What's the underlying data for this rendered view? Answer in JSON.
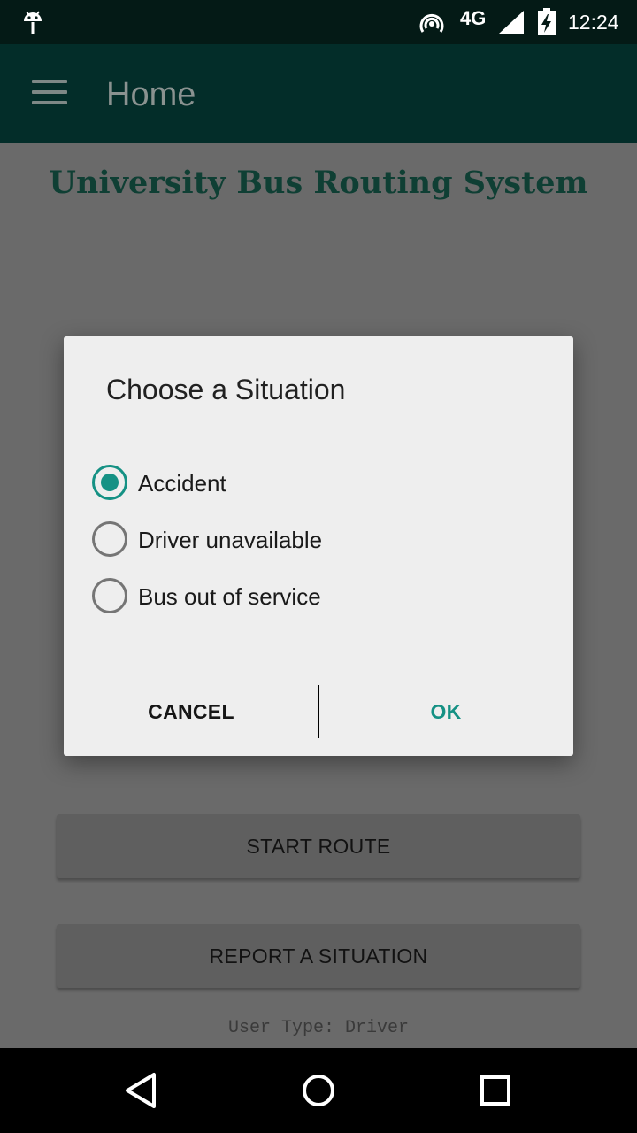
{
  "status_bar": {
    "network_type": "4G",
    "time": "12:24",
    "icons": [
      "android-debug-icon",
      "hotspot-icon",
      "signal-icon",
      "battery-charging-icon"
    ]
  },
  "app_bar": {
    "title": "Home",
    "menu_icon": "hamburger-menu-icon"
  },
  "main": {
    "heading": "University Bus Routing System",
    "start_route_label": "START ROUTE",
    "report_situation_label": "REPORT A SITUATION",
    "user_type_text": "User Type: Driver"
  },
  "dialog": {
    "title": "Choose a Situation",
    "options": [
      {
        "label": "Accident",
        "checked": true
      },
      {
        "label": "Driver unavailable",
        "checked": false
      },
      {
        "label": "Bus out of service",
        "checked": false
      }
    ],
    "cancel_label": "CANCEL",
    "ok_label": "OK"
  },
  "nav_bar": {
    "icons": [
      "back-triangle-icon",
      "home-circle-icon",
      "recents-square-icon"
    ]
  },
  "colors": {
    "accent": "#159184",
    "app_bar": "#032d29",
    "status_bar": "#041a16",
    "heading": "#0f3f34",
    "scrim_background": "#6a6a6a"
  }
}
